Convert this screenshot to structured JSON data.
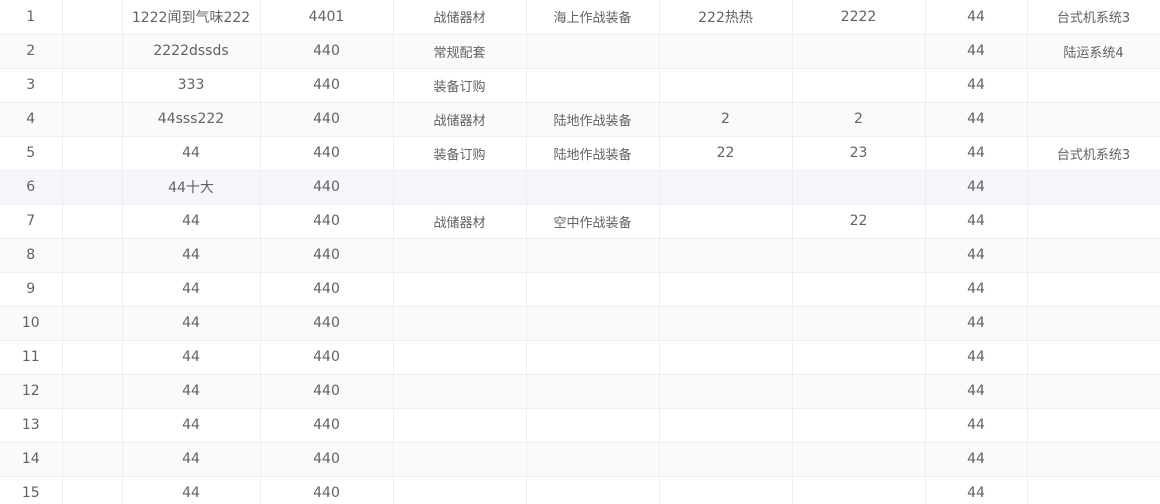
{
  "table": {
    "rows": [
      [
        "1",
        "",
        "1222闻到气味222",
        "4401",
        "战储器材",
        "海上作战装备",
        "222热热",
        "2222",
        "44",
        "台式机系统3"
      ],
      [
        "2",
        "",
        "2222dssds",
        "440",
        "常规配套",
        "",
        "",
        "",
        "44",
        "陆运系统4"
      ],
      [
        "3",
        "",
        "333",
        "440",
        "装备订购",
        "",
        "",
        "",
        "44",
        ""
      ],
      [
        "4",
        "",
        "44sss222",
        "440",
        "战储器材",
        "陆地作战装备",
        "2",
        "2",
        "44",
        ""
      ],
      [
        "5",
        "",
        "44",
        "440",
        "装备订购",
        "陆地作战装备",
        "22",
        "23",
        "44",
        "台式机系统3"
      ],
      [
        "6",
        "",
        "44十大",
        "440",
        "",
        "",
        "",
        "",
        "44",
        ""
      ],
      [
        "7",
        "",
        "44",
        "440",
        "战储器材",
        "空中作战装备",
        "",
        "22",
        "44",
        ""
      ],
      [
        "8",
        "",
        "44",
        "440",
        "",
        "",
        "",
        "",
        "44",
        ""
      ],
      [
        "9",
        "",
        "44",
        "440",
        "",
        "",
        "",
        "",
        "44",
        ""
      ],
      [
        "10",
        "",
        "44",
        "440",
        "",
        "",
        "",
        "",
        "44",
        ""
      ],
      [
        "11",
        "",
        "44",
        "440",
        "",
        "",
        "",
        "",
        "44",
        ""
      ],
      [
        "12",
        "",
        "44",
        "440",
        "",
        "",
        "",
        "",
        "44",
        ""
      ],
      [
        "13",
        "",
        "44",
        "440",
        "",
        "",
        "",
        "",
        "44",
        ""
      ],
      [
        "14",
        "",
        "44",
        "440",
        "",
        "",
        "",
        "",
        "44",
        ""
      ],
      [
        "15",
        "",
        "44",
        "440",
        "",
        "",
        "",
        "",
        "44",
        ""
      ]
    ]
  }
}
